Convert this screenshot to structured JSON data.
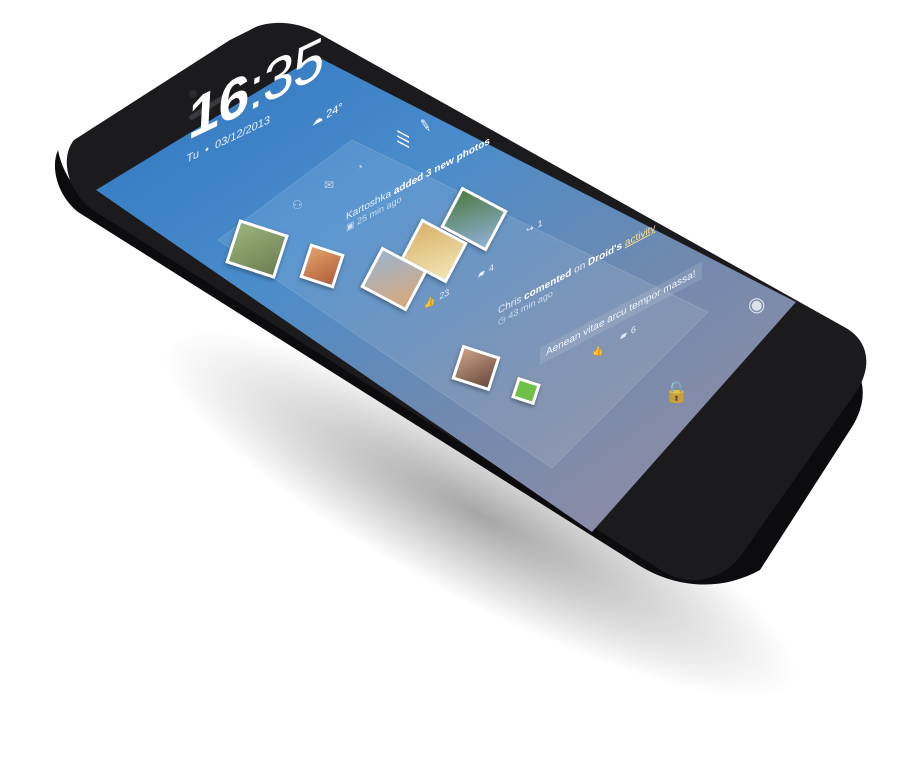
{
  "lockscreen": {
    "time_hour": "16",
    "time_minute": "35",
    "day": "Tu",
    "date": "03/12/2013",
    "temperature": "24°"
  },
  "feed": {
    "post1": {
      "author": "Kartoshka",
      "action": "added 3 new photos",
      "time": "25 min ago",
      "likes": "23",
      "comments": "4",
      "shares": "1"
    },
    "post2": {
      "author": "Chris",
      "action": "comented",
      "preposition": "on",
      "target": "Droid's",
      "target_link": "activity",
      "time": "43 min ago",
      "comment_text": "Aenean vitae arcu tempor massa!",
      "likes_count": "6"
    }
  },
  "icons": {
    "menu": "menu-icon",
    "edit": "edit-icon",
    "weather": "weather-icon",
    "camera": "camera-icon",
    "lock": "lock-icon"
  }
}
